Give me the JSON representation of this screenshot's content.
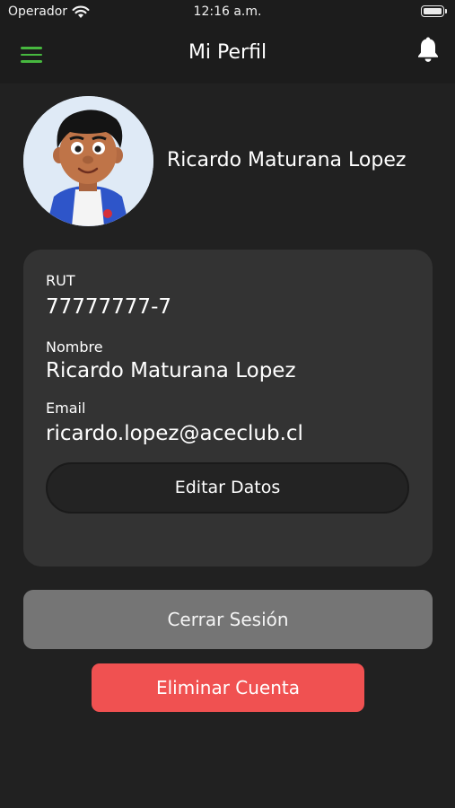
{
  "status_bar": {
    "carrier": "Operador",
    "time": "12:16 a.m.",
    "wifi_icon": "wifi-icon",
    "battery_icon": "battery-full-icon"
  },
  "header": {
    "title": "Mi Perfil",
    "menu_icon": "hamburger-menu-icon",
    "notification_icon": "bell-icon",
    "accent_color": "#47b83f"
  },
  "profile": {
    "name": "Ricardo Maturana Lopez",
    "avatar": "3d-cartoon-avatar"
  },
  "info_card": {
    "rut_label": "RUT",
    "rut_value": "77777777-7",
    "name_label": "Nombre",
    "name_value": "Ricardo Maturana Lopez",
    "email_label": "Email",
    "email_value": "ricardo.lopez@aceclub.cl",
    "edit_button": "Editar Datos"
  },
  "actions": {
    "logout_button": "Cerrar Sesión",
    "delete_button": "Eliminar Cuenta",
    "delete_color": "#f05151"
  }
}
